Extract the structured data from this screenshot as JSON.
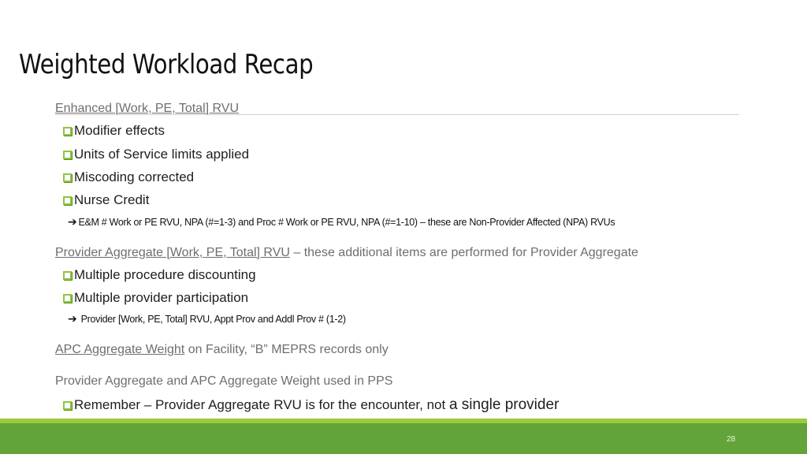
{
  "slide": {
    "title": "Weighted Workload Recap",
    "page_number": "28",
    "colors": {
      "accent_green": "#62a33a",
      "accent_light_green": "#9ccc3c",
      "bullet_green": "#8dc63f"
    }
  },
  "sections": {
    "enhanced": {
      "heading": "Enhanced [Work, PE, Total] RVU",
      "items": [
        "Modifier effects",
        "Units of Service limits applied",
        "Miscoding corrected",
        "Nurse Credit"
      ],
      "arrow_note": "E&M # Work or PE RVU, NPA (#=1-3) and Proc # Work or PE RVU, NPA (#=1-10) – these are Non-Provider Affected (NPA) RVUs"
    },
    "provider_aggregate": {
      "heading_underlined": "Provider Aggregate [Work, PE, Total] RVU",
      "heading_rest": " – these additional items are performed for Provider Aggregate",
      "items": [
        "Multiple procedure discounting",
        "Multiple provider participation"
      ],
      "arrow_note": "Provider [Work, PE, Total] RVU, Appt Prov and Addl Prov # (1-2)"
    },
    "apc": {
      "heading_underlined": "APC Aggregate Weight",
      "heading_rest": " on Facility, “B” MEPRS records only"
    },
    "pps": {
      "heading": "Provider Aggregate and APC Aggregate Weight used in PPS",
      "item_main": "Remember – Provider Aggregate RVU is for the encounter, not ",
      "item_emphasis": "a single provider"
    }
  },
  "icons": {
    "bullet": "checkbox-square-icon",
    "arrow": "right-arrow-icon",
    "arrow_glyph": "➔"
  }
}
